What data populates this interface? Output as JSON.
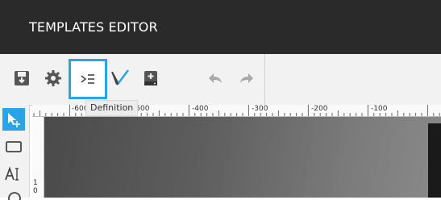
{
  "header": {
    "title": "TEMPLATES EDITOR"
  },
  "toolbar": {
    "buttons": [
      {
        "name": "save-icon"
      },
      {
        "name": "gear-icon"
      },
      {
        "name": "definition-icon",
        "active": true
      },
      {
        "name": "pen-icon"
      },
      {
        "name": "add-storage-icon"
      },
      {
        "name": "undo-icon"
      },
      {
        "name": "redo-icon"
      }
    ],
    "tooltip": "Definition"
  },
  "ruler": {
    "top_labels": [
      "-600",
      "-500",
      "-400",
      "-300",
      "-200",
      "-100"
    ],
    "left_labels": [
      "1",
      "0"
    ]
  },
  "tools": [
    {
      "name": "select-tool-icon",
      "selected": true
    },
    {
      "name": "rectangle-tool-icon"
    },
    {
      "name": "text-tool-icon"
    }
  ],
  "colors": {
    "header_bg": "#2a2a2a",
    "accent": "#2aa4e8",
    "toolbar_bg": "#f2f2f2"
  }
}
